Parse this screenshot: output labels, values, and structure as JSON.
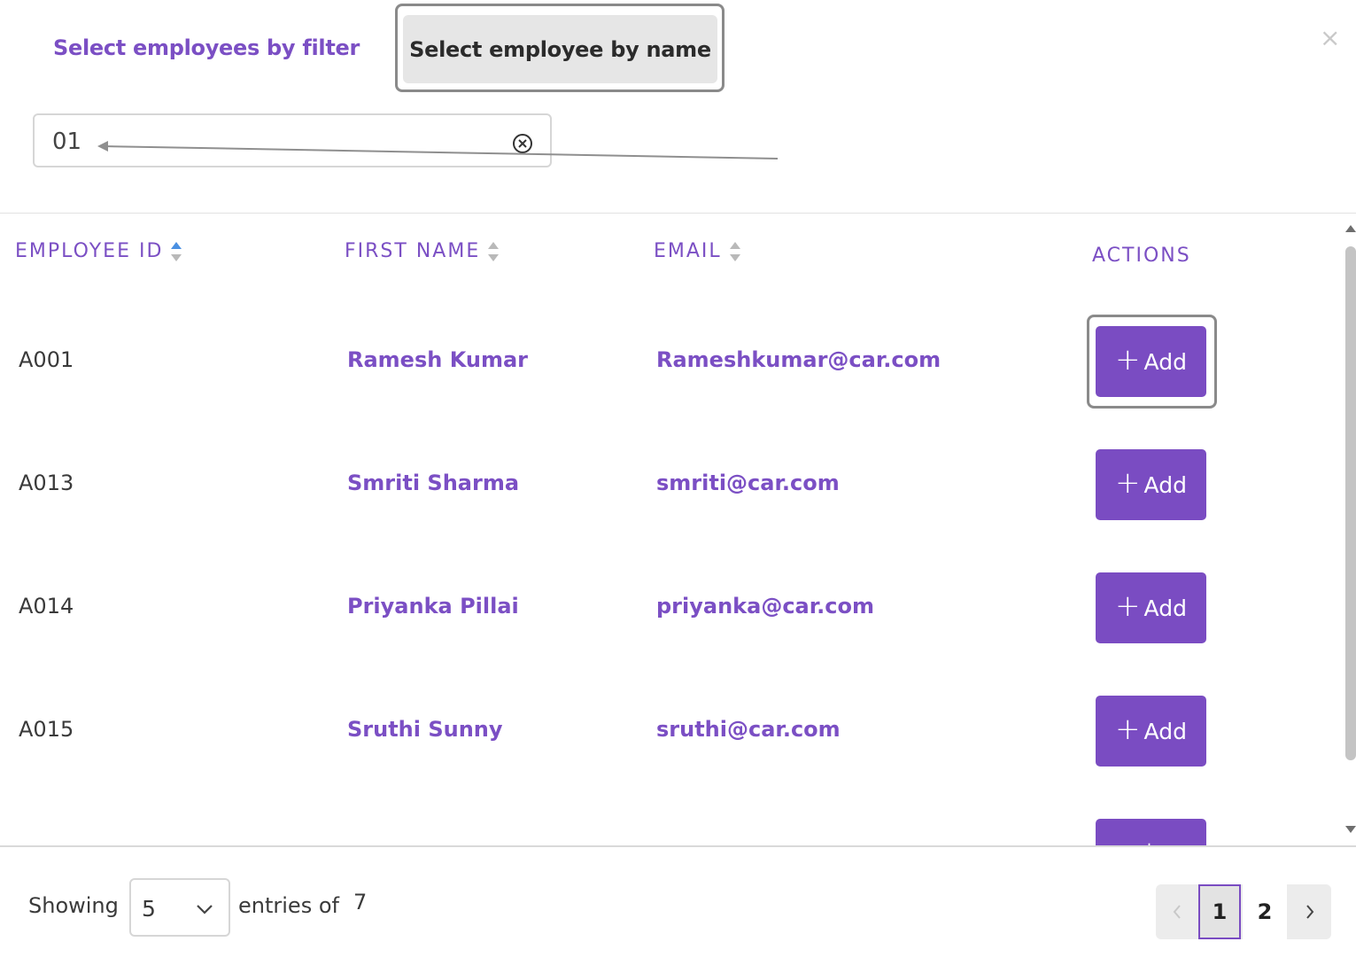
{
  "tabs": {
    "filter_label": "Select employees by filter",
    "name_label": "Select employee by name"
  },
  "close_icon": "close-icon",
  "search": {
    "value": "01",
    "clear_icon": "clear-circle-icon"
  },
  "table": {
    "headers": {
      "employee_id": "EMPLOYEE ID",
      "first_name": "FIRST NAME",
      "email": "EMAIL",
      "actions": "ACTIONS"
    },
    "sort_active_color": "#4a90e2",
    "rows": [
      {
        "id": "A001",
        "name": "Ramesh Kumar",
        "email": "Rameshkumar@car.com",
        "action": "Add"
      },
      {
        "id": "A013",
        "name": "Smriti Sharma",
        "email": "smriti@car.com",
        "action": "Add"
      },
      {
        "id": "A014",
        "name": "Priyanka Pillai",
        "email": "priyanka@car.com",
        "action": "Add"
      },
      {
        "id": "A015",
        "name": "Sruthi Sunny",
        "email": "sruthi@car.com",
        "action": "Add"
      },
      {
        "id": "",
        "name": "",
        "email": "",
        "action": ""
      }
    ]
  },
  "footer": {
    "showing_label": "Showing",
    "page_size": "5",
    "entries_label": "entries of",
    "total": "7",
    "pages": [
      "1",
      "2"
    ],
    "current_page": "1"
  },
  "colors": {
    "accent": "#7b4fc4",
    "button": "#7a4cc2"
  }
}
